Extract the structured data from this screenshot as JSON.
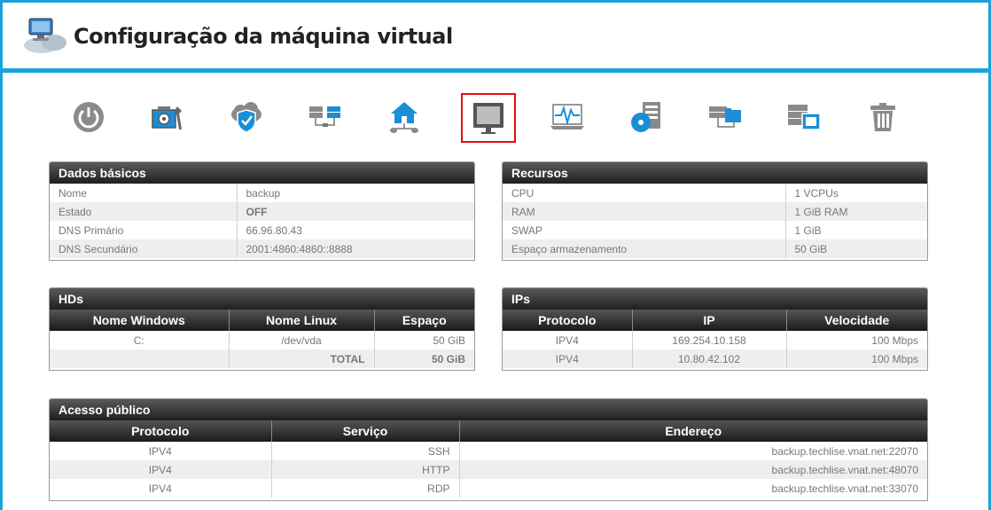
{
  "header": {
    "title": "Configuração da máquina virtual"
  },
  "toolbar": {
    "items": [
      {
        "name": "power-icon"
      },
      {
        "name": "hardware-config-icon"
      },
      {
        "name": "cloud-shield-icon"
      },
      {
        "name": "network-servers-icon"
      },
      {
        "name": "home-network-icon"
      },
      {
        "name": "monitor-icon",
        "active": true
      },
      {
        "name": "monitoring-graph-icon"
      },
      {
        "name": "disk-server-icon"
      },
      {
        "name": "server-folder-icon"
      },
      {
        "name": "server-windows-icon"
      },
      {
        "name": "trash-icon"
      }
    ]
  },
  "basic": {
    "title": "Dados básicos",
    "rows": [
      {
        "label": "Nome",
        "value": "backup"
      },
      {
        "label": "Estado",
        "value": "OFF"
      },
      {
        "label": "DNS Primário",
        "value": "66.96.80.43"
      },
      {
        "label": "DNS Secundário",
        "value": "2001:4860:4860::8888"
      }
    ]
  },
  "resources": {
    "title": "Recursos",
    "rows": [
      {
        "label": "CPU",
        "value": "1 VCPUs"
      },
      {
        "label": "RAM",
        "value": "1 GiB RAM"
      },
      {
        "label": "SWAP",
        "value": "1 GiB"
      },
      {
        "label": "Espaço armazenamento",
        "value": "50 GiB"
      }
    ]
  },
  "hds": {
    "title": "HDs",
    "headers": [
      "Nome Windows",
      "Nome Linux",
      "Espaço"
    ],
    "rows": [
      [
        "C:",
        "/dev/vda",
        "50 GiB"
      ]
    ],
    "total_label": "TOTAL",
    "total_value": "50 GiB"
  },
  "ips": {
    "title": "IPs",
    "headers": [
      "Protocolo",
      "IP",
      "Velocidade"
    ],
    "rows": [
      [
        "IPV4",
        "169.254.10.158",
        "100 Mbps"
      ],
      [
        "IPV4",
        "10.80.42.102",
        "100 Mbps"
      ]
    ]
  },
  "public": {
    "title": "Acesso público",
    "headers": [
      "Protocolo",
      "Serviço",
      "Endereço"
    ],
    "rows": [
      [
        "IPV4",
        "SSH",
        "backup.techlise.vnat.net:22070"
      ],
      [
        "IPV4",
        "HTTP",
        "backup.techlise.vnat.net:48070"
      ],
      [
        "IPV4",
        "RDP",
        "backup.techlise.vnat.net:33070"
      ]
    ]
  },
  "colors": {
    "frame": "#1aa3d9",
    "active_border": "#e01010",
    "icon_blue": "#1a8fd6",
    "icon_gray": "#8a8a8a"
  }
}
